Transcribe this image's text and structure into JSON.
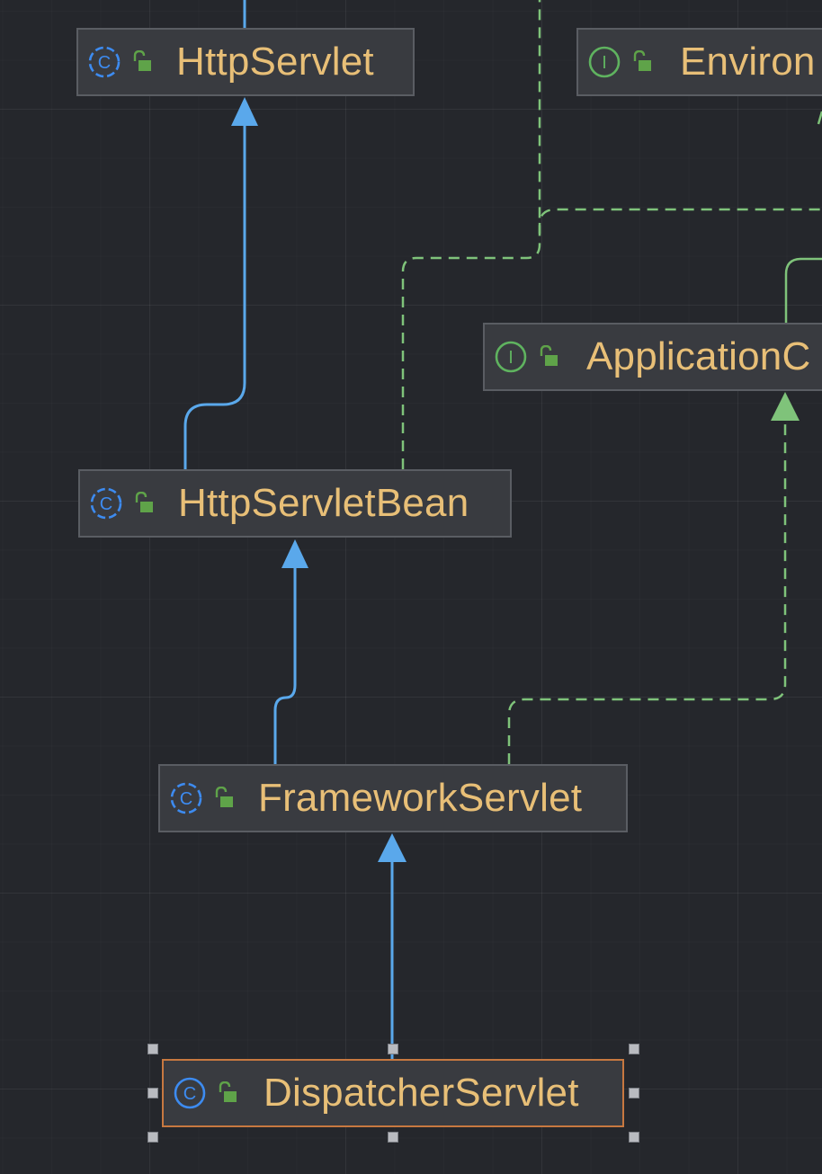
{
  "diagram": {
    "nodes": [
      {
        "id": "httpservlet",
        "name": "HttpServlet",
        "kind": "class",
        "kind_letter": "C",
        "visibility": "public"
      },
      {
        "id": "environ",
        "name": "Environ",
        "kind": "interface",
        "kind_letter": "I",
        "visibility": "public"
      },
      {
        "id": "applicationc",
        "name": "ApplicationC",
        "kind": "interface",
        "kind_letter": "I",
        "visibility": "public"
      },
      {
        "id": "httpservletbean",
        "name": "HttpServletBean",
        "kind": "class",
        "kind_letter": "C",
        "visibility": "public"
      },
      {
        "id": "frameworkservlet",
        "name": "FrameworkServlet",
        "kind": "class",
        "kind_letter": "C",
        "visibility": "public"
      },
      {
        "id": "dispatcherservlet",
        "name": "DispatcherServlet",
        "kind": "class",
        "kind_letter": "C",
        "visibility": "public",
        "selected": true
      }
    ],
    "edges": [
      {
        "from": "httpservletbean",
        "to": "httpservlet",
        "type": "extends"
      },
      {
        "from": "frameworkservlet",
        "to": "httpservletbean",
        "type": "extends"
      },
      {
        "from": "dispatcherservlet",
        "to": "frameworkservlet",
        "type": "extends"
      },
      {
        "from": "httpservletbean",
        "to": "environ",
        "type": "implements"
      },
      {
        "from": "frameworkservlet",
        "to": "applicationc",
        "type": "implements"
      },
      {
        "from": "applicationc",
        "to": "environ",
        "type": "extends-interface"
      }
    ]
  },
  "colors": {
    "background": "#25272c",
    "node_fill": "#393b40",
    "node_border": "#5a5d63",
    "selected_border": "#c77840",
    "label": "#e8bf77",
    "class_icon": "#3d8bf0",
    "interface_icon": "#5fb35f",
    "lock_icon": "#5fa349",
    "extends_edge": "#5aa8eb",
    "implements_edge": "#7fc37a"
  },
  "icons": {
    "class": "class-c-icon",
    "interface": "interface-i-icon",
    "visibility": "open-lock-icon"
  }
}
